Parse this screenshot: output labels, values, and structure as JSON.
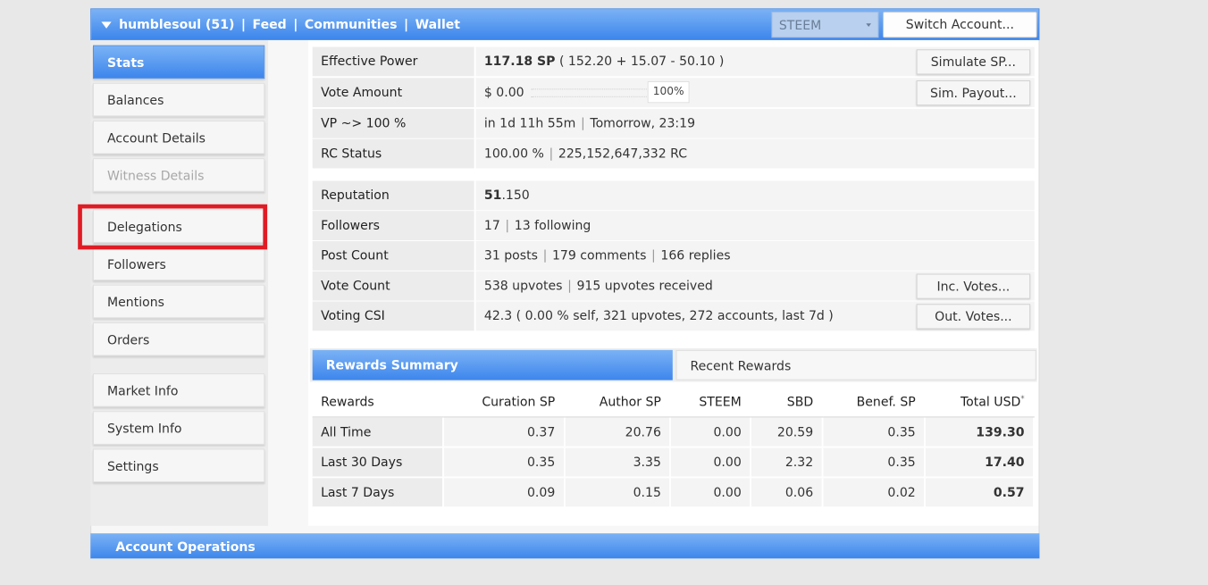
{
  "topbar": {
    "user": "humblesoul (51)",
    "nav": [
      "Feed",
      "Communities",
      "Wallet"
    ],
    "currency_select": "STEEM",
    "switch_account": "Switch Account..."
  },
  "sidebar": {
    "items": [
      {
        "label": "Stats",
        "state": "active"
      },
      {
        "label": "Balances"
      },
      {
        "label": "Account Details"
      },
      {
        "label": "Witness Details",
        "state": "disabled"
      },
      {
        "label": "Delegations"
      },
      {
        "label": "Followers"
      },
      {
        "label": "Mentions"
      },
      {
        "label": "Orders"
      },
      {
        "label": "Market Info"
      },
      {
        "label": "System Info"
      },
      {
        "label": "Settings"
      }
    ]
  },
  "stats": {
    "effective_power": {
      "label": "Effective Power",
      "value_bold": "117.18 SP",
      "value_rest": " ( 152.20 + 15.07 - 50.10 )",
      "button": "Simulate SP..."
    },
    "vote_amount": {
      "label": "Vote Amount",
      "value": "$ 0.00",
      "pct": "100%",
      "button": "Sim. Payout..."
    },
    "vp": {
      "label": "VP ~> 100 %",
      "value1": "in 1d 11h 55m",
      "value2": "Tomorrow, 23:19"
    },
    "rc": {
      "label": "RC Status",
      "value1": "100.00 %",
      "value2": "225,152,647,332 RC"
    },
    "reputation": {
      "label": "Reputation",
      "value_bold": "51",
      "value_rest": ".150"
    },
    "followers": {
      "label": "Followers",
      "value1": "17",
      "value2": "13 following"
    },
    "post_count": {
      "label": "Post Count",
      "value1": "31 posts",
      "value2": "179 comments",
      "value3": "166 replies"
    },
    "vote_count": {
      "label": "Vote Count",
      "value1": "538 upvotes",
      "value2": "915 upvotes received",
      "button": "Inc. Votes..."
    },
    "voting_csi": {
      "label": "Voting CSI",
      "value": "42.3 ( 0.00 % self, 321 upvotes, 272 accounts, last 7d )",
      "button": "Out. Votes..."
    }
  },
  "rewards_tabs": {
    "active": "Rewards Summary",
    "inactive": "Recent Rewards"
  },
  "rewards": {
    "headers": [
      "Rewards",
      "Curation SP",
      "Author SP",
      "STEEM",
      "SBD",
      "Benef. SP",
      "Total USD"
    ],
    "total_mark": "*",
    "rows": [
      [
        "All Time",
        "0.37",
        "20.76",
        "0.00",
        "20.59",
        "0.35",
        "139.30"
      ],
      [
        "Last 30 Days",
        "0.35",
        "3.35",
        "0.00",
        "2.32",
        "0.35",
        "17.40"
      ],
      [
        "Last 7 Days",
        "0.09",
        "0.15",
        "0.00",
        "0.06",
        "0.02",
        "0.57"
      ]
    ]
  },
  "bottom_bar": "Account Operations"
}
